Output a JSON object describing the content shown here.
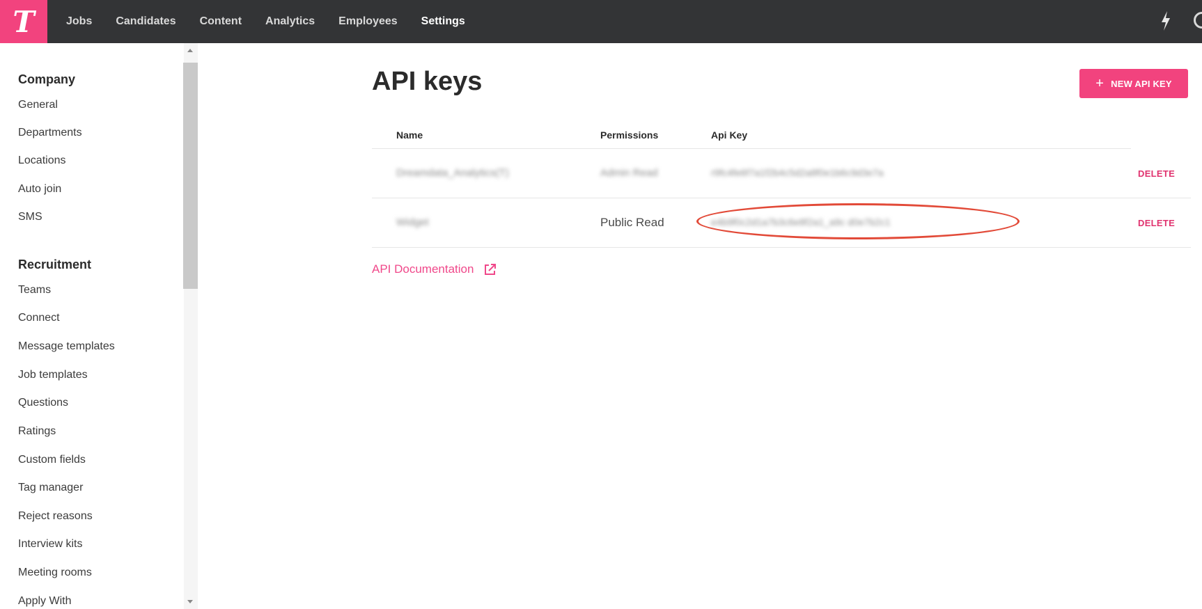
{
  "app": {
    "logo_letter": "T",
    "brand_color": "#f2437e",
    "topbar_color": "#333436"
  },
  "nav": {
    "items": [
      "Jobs",
      "Candidates",
      "Content",
      "Analytics",
      "Employees",
      "Settings"
    ],
    "active": "Settings"
  },
  "topbar_icons": [
    "bolt-icon",
    "circle-icon"
  ],
  "sidebar": {
    "sections": [
      {
        "title": "Company",
        "items": [
          "General",
          "Departments",
          "Locations",
          "Auto join",
          "SMS"
        ]
      },
      {
        "title": "Recruitment",
        "items": [
          "Teams",
          "Connect",
          "Message templates",
          "Job templates",
          "Questions",
          "Ratings",
          "Custom fields",
          "Tag manager",
          "Reject reasons",
          "Interview kits",
          "Meeting rooms",
          "Apply With"
        ]
      }
    ]
  },
  "main": {
    "title": "API keys",
    "new_button_label": "NEW API KEY",
    "table": {
      "headers": [
        "Name",
        "Permissions",
        "Api Key"
      ],
      "rows": [
        {
          "name": "Dreamdata_Analytics(T)",
          "permissions": "Admin Read",
          "api_key": "r9fc4fe6f7a1f2b4c5d2a8f0e1b6c9d3e7a",
          "action": "DELETE"
        },
        {
          "name": "Widget",
          "permissions": "Public Read",
          "api_key": "e4b9f0c2d1a7b3c6e8f2a1_a9c d0e7b2c1",
          "action": "DELETE"
        }
      ]
    },
    "doc_link": "API Documentation",
    "highlight_color": "#e24a38"
  }
}
